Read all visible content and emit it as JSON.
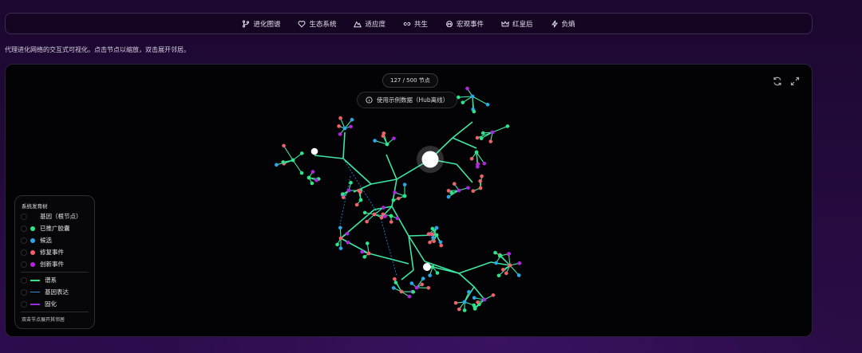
{
  "nav": {
    "items": [
      {
        "label": "进化图谱",
        "icon": "branch-icon"
      },
      {
        "label": "生态系统",
        "icon": "heart-icon"
      },
      {
        "label": "适应度",
        "icon": "mountain-icon"
      },
      {
        "label": "共生",
        "icon": "link-icon"
      },
      {
        "label": "宏观事件",
        "icon": "skull-icon"
      },
      {
        "label": "红皇后",
        "icon": "crown-icon"
      },
      {
        "label": "负熵",
        "icon": "bolt-icon"
      }
    ]
  },
  "subtitle": "代理进化网络的交互式可视化。点击节点以缩放，双击展开邻居。",
  "panel": {
    "count": "127 / 500 节点",
    "data_source": "使用示例数据（Hub离线）"
  },
  "legend": {
    "title": "系统发育树",
    "items": [
      {
        "label": "基因（根节点）",
        "color": "#ffffff"
      },
      {
        "label": "已推广胶囊",
        "color": "#2ee68a"
      },
      {
        "label": "候选",
        "color": "#2aa8e8"
      },
      {
        "label": "修复事件",
        "color": "#f0626a"
      },
      {
        "label": "创新事件",
        "color": "#b026e0"
      }
    ],
    "edges": [
      {
        "label": "谱系",
        "color": "#2ee68a"
      },
      {
        "label": "基因表达",
        "color": "#2a8fd8"
      },
      {
        "label": "固化",
        "color": "#9b2be0"
      }
    ],
    "hint": "双击节点展开其邻居"
  },
  "colors": {
    "lineage": "#3ee8a4",
    "gene": "#2a8fd8",
    "solid": "#9b2be0",
    "promoted": "#2ee68a",
    "candidate": "#2aa8e8",
    "repair": "#f0626a",
    "innovate": "#b026e0"
  }
}
